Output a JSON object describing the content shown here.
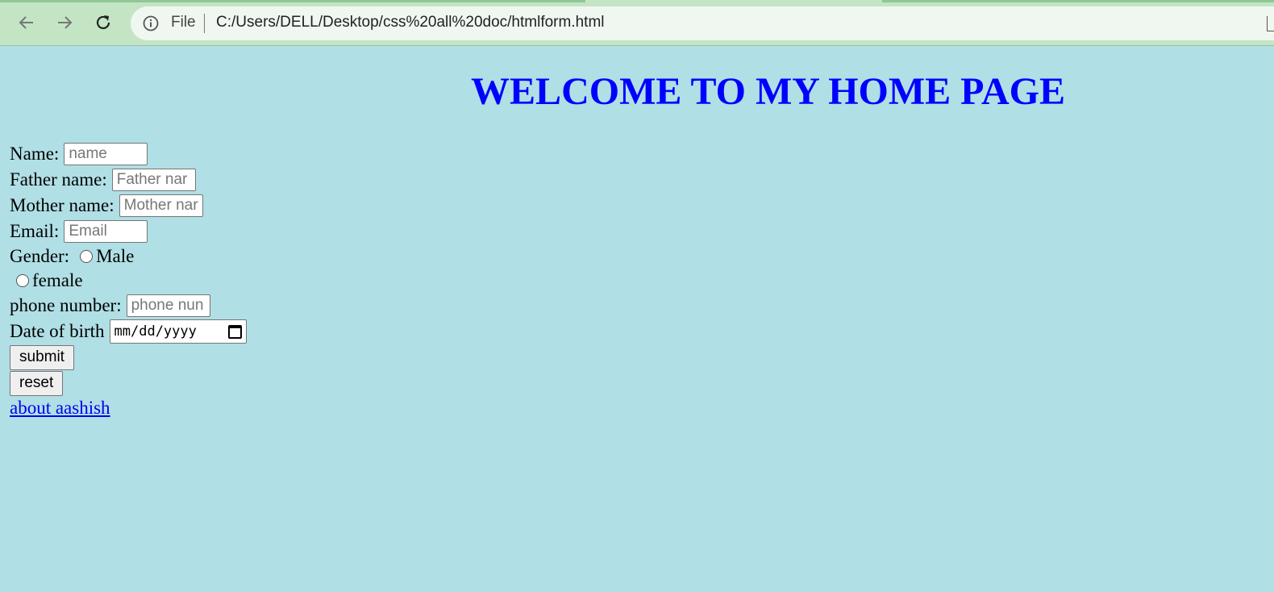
{
  "browser": {
    "back_icon": "arrow-left-icon",
    "forward_icon": "arrow-right-icon",
    "reload_icon": "reload-icon",
    "info_icon": "info-icon",
    "scheme_label": "File",
    "url": "C:/Users/DELL/Desktop/css%20all%20doc/htmlform.html"
  },
  "page": {
    "background_color": "#b0dfe5",
    "heading": "WELCOME TO MY HOME PAGE",
    "heading_color": "#0000ff"
  },
  "form": {
    "name": {
      "label": "Name:",
      "placeholder": "name",
      "value": ""
    },
    "father_name": {
      "label": "Father name:",
      "placeholder": "Father nar",
      "value": ""
    },
    "mother_name": {
      "label": "Mother name:",
      "placeholder": "Mother nar",
      "value": ""
    },
    "email": {
      "label": "Email:",
      "placeholder": "Email",
      "value": ""
    },
    "gender": {
      "label": "Gender:",
      "options": [
        {
          "label": "Male",
          "checked": false
        },
        {
          "label": "female",
          "checked": false
        }
      ]
    },
    "phone": {
      "label": "phone number:",
      "placeholder": "phone nun",
      "value": ""
    },
    "dob": {
      "label": "Date of birth",
      "display": "mm/dd/yyyy"
    },
    "submit_label": "submit",
    "reset_label": "reset",
    "about_link": "about aashish"
  }
}
